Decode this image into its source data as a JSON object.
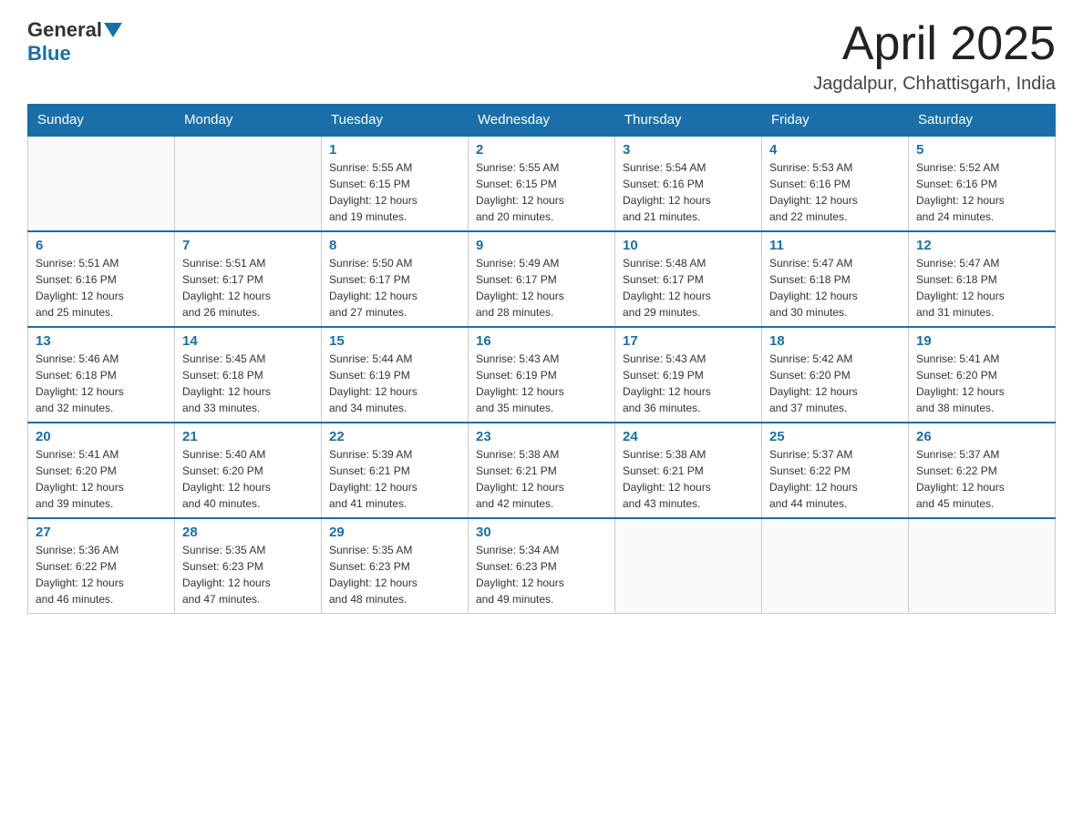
{
  "header": {
    "logo_general": "General",
    "logo_blue": "Blue",
    "title": "April 2025",
    "subtitle": "Jagdalpur, Chhattisgarh, India"
  },
  "weekdays": [
    "Sunday",
    "Monday",
    "Tuesday",
    "Wednesday",
    "Thursday",
    "Friday",
    "Saturday"
  ],
  "weeks": [
    [
      {
        "day": "",
        "info": ""
      },
      {
        "day": "",
        "info": ""
      },
      {
        "day": "1",
        "info": "Sunrise: 5:55 AM\nSunset: 6:15 PM\nDaylight: 12 hours\nand 19 minutes."
      },
      {
        "day": "2",
        "info": "Sunrise: 5:55 AM\nSunset: 6:15 PM\nDaylight: 12 hours\nand 20 minutes."
      },
      {
        "day": "3",
        "info": "Sunrise: 5:54 AM\nSunset: 6:16 PM\nDaylight: 12 hours\nand 21 minutes."
      },
      {
        "day": "4",
        "info": "Sunrise: 5:53 AM\nSunset: 6:16 PM\nDaylight: 12 hours\nand 22 minutes."
      },
      {
        "day": "5",
        "info": "Sunrise: 5:52 AM\nSunset: 6:16 PM\nDaylight: 12 hours\nand 24 minutes."
      }
    ],
    [
      {
        "day": "6",
        "info": "Sunrise: 5:51 AM\nSunset: 6:16 PM\nDaylight: 12 hours\nand 25 minutes."
      },
      {
        "day": "7",
        "info": "Sunrise: 5:51 AM\nSunset: 6:17 PM\nDaylight: 12 hours\nand 26 minutes."
      },
      {
        "day": "8",
        "info": "Sunrise: 5:50 AM\nSunset: 6:17 PM\nDaylight: 12 hours\nand 27 minutes."
      },
      {
        "day": "9",
        "info": "Sunrise: 5:49 AM\nSunset: 6:17 PM\nDaylight: 12 hours\nand 28 minutes."
      },
      {
        "day": "10",
        "info": "Sunrise: 5:48 AM\nSunset: 6:17 PM\nDaylight: 12 hours\nand 29 minutes."
      },
      {
        "day": "11",
        "info": "Sunrise: 5:47 AM\nSunset: 6:18 PM\nDaylight: 12 hours\nand 30 minutes."
      },
      {
        "day": "12",
        "info": "Sunrise: 5:47 AM\nSunset: 6:18 PM\nDaylight: 12 hours\nand 31 minutes."
      }
    ],
    [
      {
        "day": "13",
        "info": "Sunrise: 5:46 AM\nSunset: 6:18 PM\nDaylight: 12 hours\nand 32 minutes."
      },
      {
        "day": "14",
        "info": "Sunrise: 5:45 AM\nSunset: 6:18 PM\nDaylight: 12 hours\nand 33 minutes."
      },
      {
        "day": "15",
        "info": "Sunrise: 5:44 AM\nSunset: 6:19 PM\nDaylight: 12 hours\nand 34 minutes."
      },
      {
        "day": "16",
        "info": "Sunrise: 5:43 AM\nSunset: 6:19 PM\nDaylight: 12 hours\nand 35 minutes."
      },
      {
        "day": "17",
        "info": "Sunrise: 5:43 AM\nSunset: 6:19 PM\nDaylight: 12 hours\nand 36 minutes."
      },
      {
        "day": "18",
        "info": "Sunrise: 5:42 AM\nSunset: 6:20 PM\nDaylight: 12 hours\nand 37 minutes."
      },
      {
        "day": "19",
        "info": "Sunrise: 5:41 AM\nSunset: 6:20 PM\nDaylight: 12 hours\nand 38 minutes."
      }
    ],
    [
      {
        "day": "20",
        "info": "Sunrise: 5:41 AM\nSunset: 6:20 PM\nDaylight: 12 hours\nand 39 minutes."
      },
      {
        "day": "21",
        "info": "Sunrise: 5:40 AM\nSunset: 6:20 PM\nDaylight: 12 hours\nand 40 minutes."
      },
      {
        "day": "22",
        "info": "Sunrise: 5:39 AM\nSunset: 6:21 PM\nDaylight: 12 hours\nand 41 minutes."
      },
      {
        "day": "23",
        "info": "Sunrise: 5:38 AM\nSunset: 6:21 PM\nDaylight: 12 hours\nand 42 minutes."
      },
      {
        "day": "24",
        "info": "Sunrise: 5:38 AM\nSunset: 6:21 PM\nDaylight: 12 hours\nand 43 minutes."
      },
      {
        "day": "25",
        "info": "Sunrise: 5:37 AM\nSunset: 6:22 PM\nDaylight: 12 hours\nand 44 minutes."
      },
      {
        "day": "26",
        "info": "Sunrise: 5:37 AM\nSunset: 6:22 PM\nDaylight: 12 hours\nand 45 minutes."
      }
    ],
    [
      {
        "day": "27",
        "info": "Sunrise: 5:36 AM\nSunset: 6:22 PM\nDaylight: 12 hours\nand 46 minutes."
      },
      {
        "day": "28",
        "info": "Sunrise: 5:35 AM\nSunset: 6:23 PM\nDaylight: 12 hours\nand 47 minutes."
      },
      {
        "day": "29",
        "info": "Sunrise: 5:35 AM\nSunset: 6:23 PM\nDaylight: 12 hours\nand 48 minutes."
      },
      {
        "day": "30",
        "info": "Sunrise: 5:34 AM\nSunset: 6:23 PM\nDaylight: 12 hours\nand 49 minutes."
      },
      {
        "day": "",
        "info": ""
      },
      {
        "day": "",
        "info": ""
      },
      {
        "day": "",
        "info": ""
      }
    ]
  ]
}
